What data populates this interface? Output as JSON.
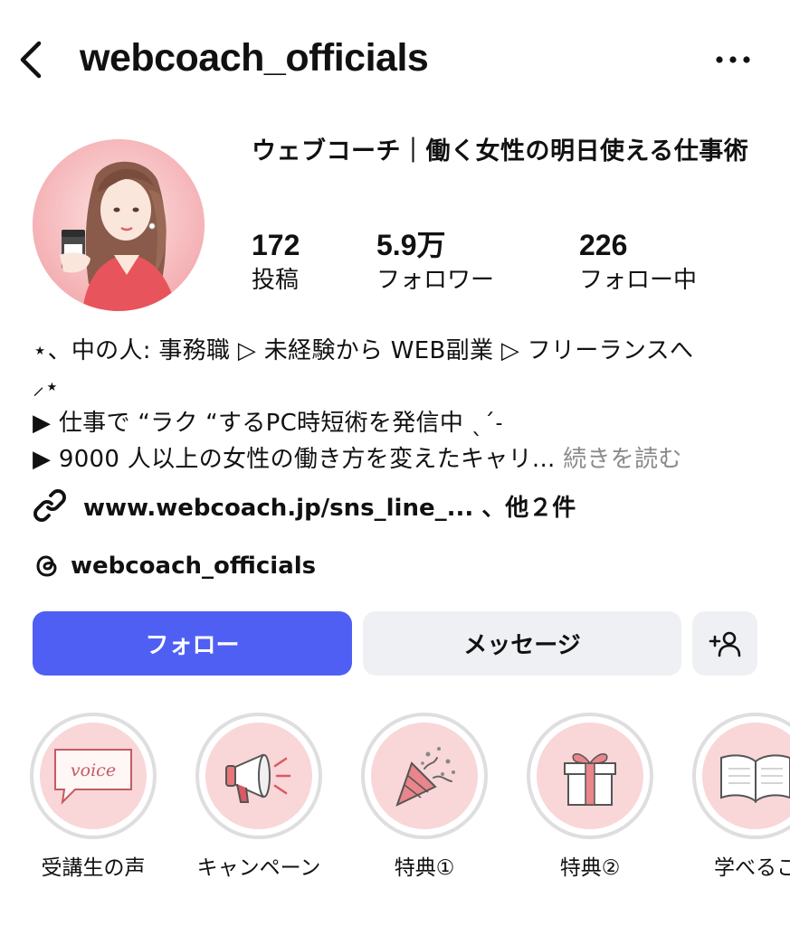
{
  "header": {
    "username": "webcoach_officials"
  },
  "profile": {
    "display_name": "ウェブコーチ｜働く女性の明日使える仕事術",
    "stats": [
      {
        "value": "172",
        "label": "投稿"
      },
      {
        "value": "5.9万",
        "label": "フォロワー"
      },
      {
        "value": "226",
        "label": "フォロー中"
      }
    ]
  },
  "bio": {
    "line1": "⋆、中の人: 事務職 ▷ 未経験から WEB副業 ▷ フリーランスへ",
    "line2": "⸝⋆",
    "line3": "▶ 仕事で “ラク “するPC時短術を発信中 ˎˊ˗",
    "line4": "▶ 9000 人以上の女性の働き方を変えたキャリ...",
    "more": "続きを読む"
  },
  "link": {
    "text": "www.webcoach.jp/sns_line_... 、他２件"
  },
  "threads": {
    "handle": "webcoach_officials"
  },
  "actions": {
    "follow_label": "フォロー",
    "message_label": "メッセージ",
    "add_person_icon": "add-person-icon"
  },
  "highlights": [
    {
      "label": "受講生の声",
      "icon": "voice-bubble-icon"
    },
    {
      "label": "キャンペーン",
      "icon": "megaphone-icon"
    },
    {
      "label": "特典①",
      "icon": "party-popper-icon"
    },
    {
      "label": "特典②",
      "icon": "gift-box-icon"
    },
    {
      "label": "学べるこ",
      "icon": "open-book-icon"
    }
  ],
  "colors": {
    "follow_button": "#4f5ff4",
    "secondary_button": "#eff0f3",
    "highlight_bg": "#f9d6d8",
    "muted_text": "#8a8a8a"
  }
}
